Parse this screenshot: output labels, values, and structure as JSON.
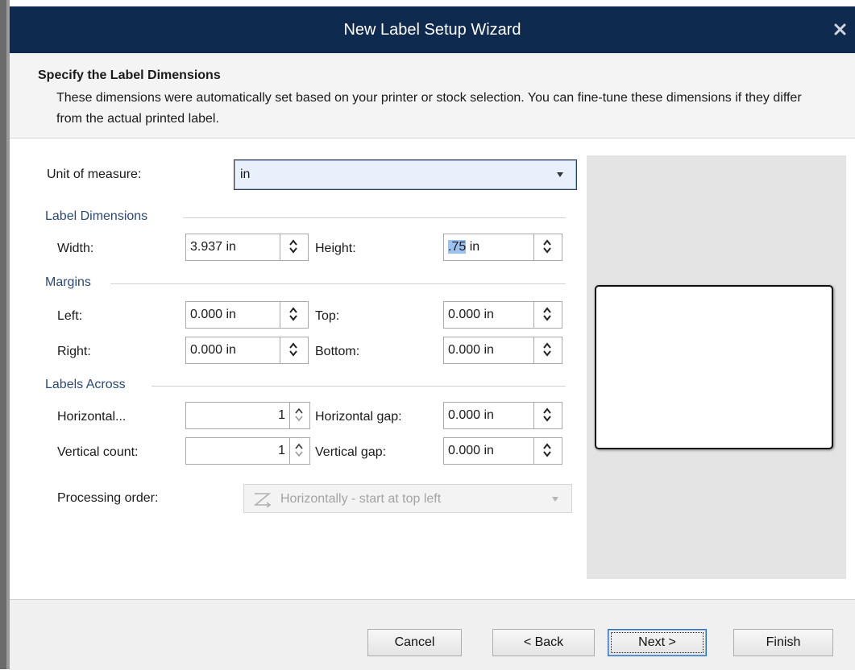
{
  "window": {
    "title": "New Label Setup Wizard",
    "close_icon": "close-icon"
  },
  "header": {
    "heading": "Specify the Label Dimensions",
    "description": "These dimensions were automatically set based on your printer or stock selection. You can fine-tune these dimensions if they differ from the actual printed label."
  },
  "unit": {
    "label": "Unit of measure:",
    "value": "in"
  },
  "dimensions": {
    "title": "Label Dimensions",
    "width_label": "Width:",
    "width_value": "3.937 in",
    "height_label": "Height:",
    "height_selected": ".75",
    "height_rest": " in"
  },
  "margins": {
    "title": "Margins",
    "left_label": "Left:",
    "left_value": "0.000 in",
    "top_label": "Top:",
    "top_value": "0.000 in",
    "right_label": "Right:",
    "right_value": "0.000 in",
    "bottom_label": "Bottom:",
    "bottom_value": "0.000 in"
  },
  "labels_across": {
    "title": "Labels Across",
    "horizontal_label": "Horizontal...",
    "horizontal_value": "1",
    "horizontal_gap_label": "Horizontal gap:",
    "horizontal_gap_value": "0.000 in",
    "vertical_label": "Vertical count:",
    "vertical_value": "1",
    "vertical_gap_label": "Vertical gap:",
    "vertical_gap_value": "0.000 in"
  },
  "processing": {
    "label": "Processing order:",
    "value": "Horizontally - start at top left"
  },
  "footer": {
    "cancel": "Cancel",
    "back": "< Back",
    "next": "Next >",
    "finish": "Finish"
  },
  "colors": {
    "titlebar": "#0f2a4f",
    "group_title": "#2a4a75",
    "selection": "#9cc3f0"
  }
}
